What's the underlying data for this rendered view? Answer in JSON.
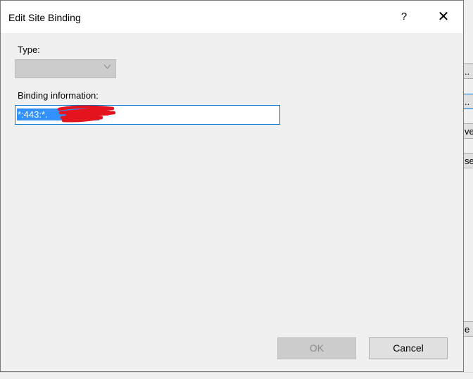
{
  "dialog": {
    "title": "Edit Site Binding",
    "help_label": "?",
    "close_label": "✕"
  },
  "form": {
    "type_label": "Type:",
    "type_value": "",
    "binding_label": "Binding information:",
    "binding_value": "*:443:*."
  },
  "buttons": {
    "ok_label": "OK",
    "cancel_label": "Cancel"
  },
  "background_window": {
    "button_fragments": [
      "..",
      "..",
      "ve",
      "se",
      "e"
    ]
  },
  "colors": {
    "selection": "#3390ff",
    "focus_border": "#0078d7",
    "redaction": "#e3141d"
  },
  "icons": {
    "close": "x-icon",
    "dropdown": "chevron-down-icon",
    "help": "question-icon"
  }
}
